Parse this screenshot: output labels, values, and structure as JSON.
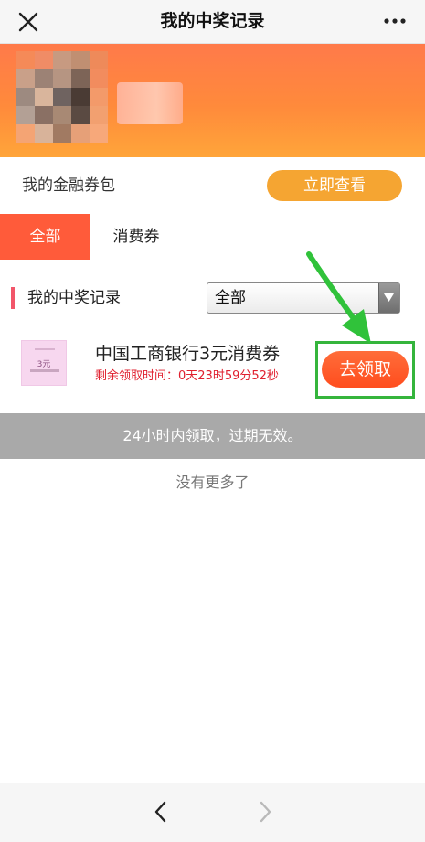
{
  "titlebar": {
    "title": "我的中奖记录"
  },
  "wallet": {
    "label": "我的金融券包",
    "button": "立即查看"
  },
  "tabs": [
    {
      "label": "全部",
      "active": true
    },
    {
      "label": "消费券",
      "active": false
    }
  ],
  "section": {
    "title": "我的中奖记录",
    "filter_value": "全部"
  },
  "prize": {
    "name": "中国工商银行3元消费券",
    "time_label": "剩余领取时间：",
    "time_value": "0天23时59分52秒",
    "claim_label": "去领取",
    "thumb_text": "3元"
  },
  "notice": "24小时内领取，过期无效。",
  "no_more": "没有更多了",
  "colors": {
    "banner": "#ff8a3b",
    "tab_active": "#ff5b3a",
    "view_button": "#f5a532",
    "claim_button": "#ff5a28",
    "highlight": "#35b53c",
    "countdown": "#e0202f"
  },
  "icons": [
    "close-icon",
    "more-icon",
    "chevron-down-icon",
    "back-icon",
    "forward-icon"
  ]
}
